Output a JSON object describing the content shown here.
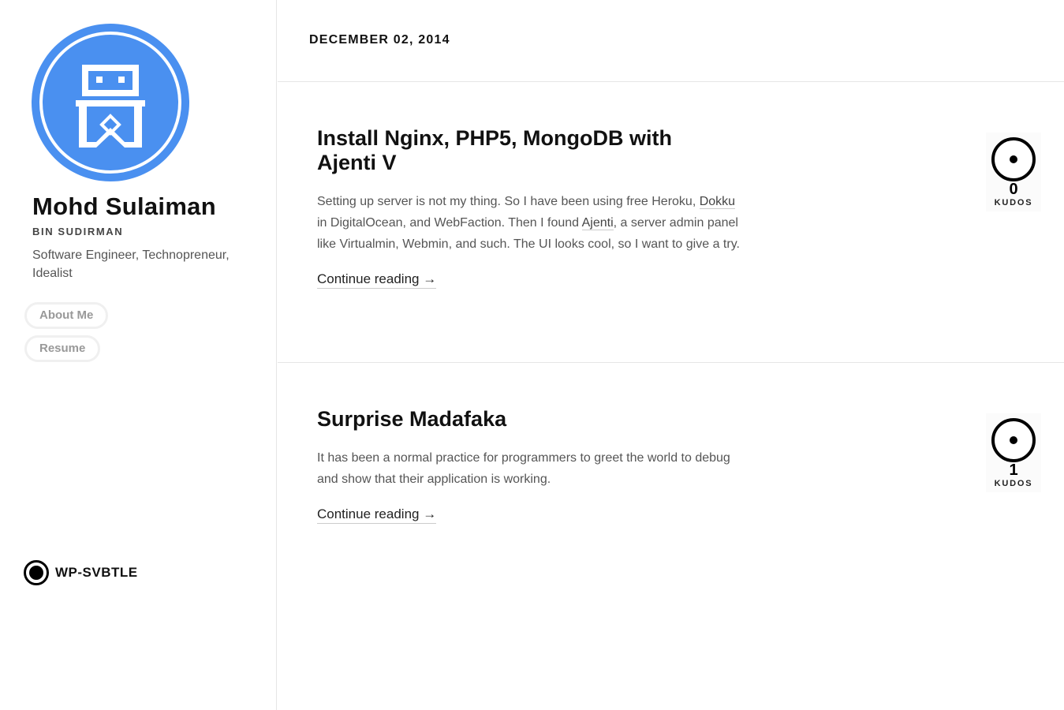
{
  "sidebar": {
    "author_name": "Mohd Sulaiman",
    "author_subtitle": "BIN SUDIRMAN",
    "author_bio": "Software Engineer, Technopreneur, Idealist",
    "nav": [
      {
        "label": "About Me"
      },
      {
        "label": "Resume"
      }
    ],
    "brand_label": "WP-SVBTLE",
    "avatar_icon": "robot-logo-icon",
    "avatar_color": "#4a90f0"
  },
  "main": {
    "date": "DECEMBER 02, 2014",
    "posts": [
      {
        "title": "Install Nginx, PHP5, MongoDB with Ajenti V",
        "excerpt_1": "Setting up server is not my thing. So I have been using free Heroku, ",
        "link_1": "Dokku ",
        "excerpt_2": "in DigitalOcean, and WebFaction. Then I found ",
        "link_2": "Ajenti",
        "excerpt_3": ", a server admin panel like Virtualmin, Webmin, and such. The UI looks cool, so I want to give a try.",
        "continue": "Continue reading →",
        "kudos_count": "0",
        "kudos_label": "KUDOS"
      },
      {
        "title": "Surprise Madafaka",
        "excerpt": "It has been a normal practice for programmers to greet  the world to debug and show that their application is working.",
        "continue": "Continue reading →",
        "kudos_count": "1",
        "kudos_label": "KUDOS"
      }
    ]
  }
}
